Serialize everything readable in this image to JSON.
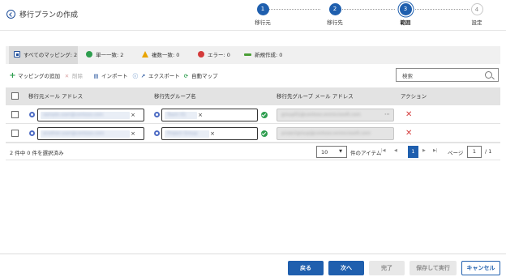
{
  "header": {
    "title": "移行プランの作成"
  },
  "wizard": {
    "steps": [
      {
        "number": "1",
        "label": "移行元",
        "state": "done"
      },
      {
        "number": "2",
        "label": "移行先",
        "state": "done"
      },
      {
        "number": "3",
        "label": "範囲",
        "state": "current"
      },
      {
        "number": "4",
        "label": "設定",
        "state": "todo"
      }
    ]
  },
  "filters": {
    "all": "すべてのマッピング: 2",
    "single": "単一一致: 2",
    "multiple": "複数一致: 0",
    "error": "エラー: 0",
    "new": "新規作成: 0"
  },
  "toolbar": {
    "add": "マッピングの追加",
    "delete": "削除",
    "import": "インポート",
    "export": "エクスポート",
    "auto_map": "自動マップ",
    "search_placeholder": "検索"
  },
  "table": {
    "columns": {
      "source_email": "移行元メール アドレス",
      "target_group": "移行先グループ名",
      "target_group_email": "移行先グループ メール アドレス",
      "action": "アクション"
    },
    "rows": [
      {
        "source_email": "sample.user@contoso.com",
        "target_group": "Team 01",
        "target_group_email": "group01@contoso.onmicrosoft.com"
      },
      {
        "source_email": "another.user@contoso.com",
        "target_group": "Project Group",
        "target_group_email": "projectgroup@contoso.onmicrosoft.com"
      }
    ]
  },
  "pager": {
    "selection": "2 件中 0 件を選択済み",
    "page_size": "10",
    "items_label": "件のアイテム",
    "current_page": "1",
    "page_label": "ページ",
    "page_input": "1",
    "page_total": "/ 1"
  },
  "footer": {
    "back": "戻る",
    "next": "次へ",
    "finish": "完了",
    "save_run": "保存して実行",
    "cancel": "キャンセル"
  },
  "colors": {
    "primary": "#1f5fae",
    "success": "#2e9e4f",
    "warning": "#e8a400",
    "error": "#d43b3b"
  }
}
